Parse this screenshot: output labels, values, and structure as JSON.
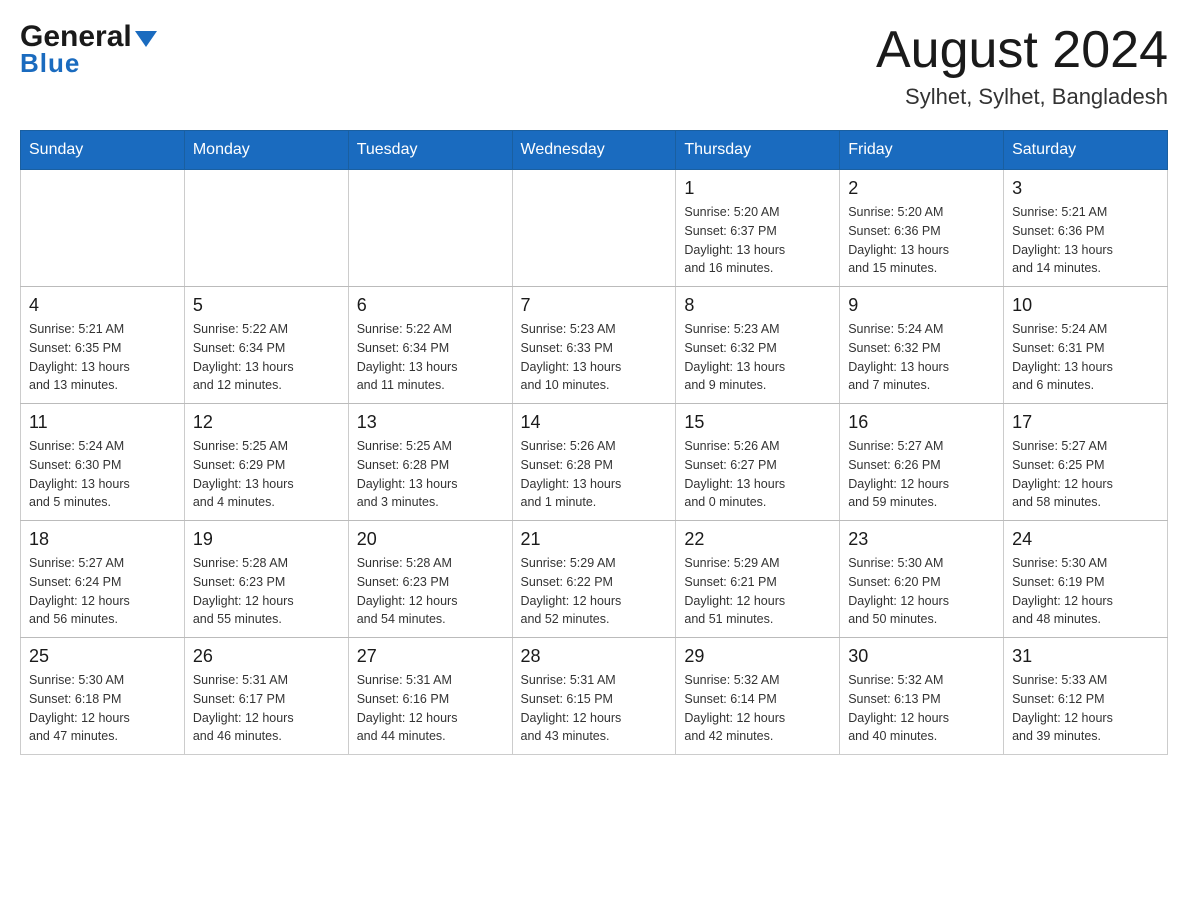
{
  "header": {
    "logo": {
      "general": "General",
      "blue": "Blue",
      "triangle": "▼"
    },
    "month_year": "August 2024",
    "location": "Sylhet, Sylhet, Bangladesh"
  },
  "calendar": {
    "days_of_week": [
      "Sunday",
      "Monday",
      "Tuesday",
      "Wednesday",
      "Thursday",
      "Friday",
      "Saturday"
    ],
    "weeks": [
      [
        {
          "day": "",
          "info": ""
        },
        {
          "day": "",
          "info": ""
        },
        {
          "day": "",
          "info": ""
        },
        {
          "day": "",
          "info": ""
        },
        {
          "day": "1",
          "info": "Sunrise: 5:20 AM\nSunset: 6:37 PM\nDaylight: 13 hours\nand 16 minutes."
        },
        {
          "day": "2",
          "info": "Sunrise: 5:20 AM\nSunset: 6:36 PM\nDaylight: 13 hours\nand 15 minutes."
        },
        {
          "day": "3",
          "info": "Sunrise: 5:21 AM\nSunset: 6:36 PM\nDaylight: 13 hours\nand 14 minutes."
        }
      ],
      [
        {
          "day": "4",
          "info": "Sunrise: 5:21 AM\nSunset: 6:35 PM\nDaylight: 13 hours\nand 13 minutes."
        },
        {
          "day": "5",
          "info": "Sunrise: 5:22 AM\nSunset: 6:34 PM\nDaylight: 13 hours\nand 12 minutes."
        },
        {
          "day": "6",
          "info": "Sunrise: 5:22 AM\nSunset: 6:34 PM\nDaylight: 13 hours\nand 11 minutes."
        },
        {
          "day": "7",
          "info": "Sunrise: 5:23 AM\nSunset: 6:33 PM\nDaylight: 13 hours\nand 10 minutes."
        },
        {
          "day": "8",
          "info": "Sunrise: 5:23 AM\nSunset: 6:32 PM\nDaylight: 13 hours\nand 9 minutes."
        },
        {
          "day": "9",
          "info": "Sunrise: 5:24 AM\nSunset: 6:32 PM\nDaylight: 13 hours\nand 7 minutes."
        },
        {
          "day": "10",
          "info": "Sunrise: 5:24 AM\nSunset: 6:31 PM\nDaylight: 13 hours\nand 6 minutes."
        }
      ],
      [
        {
          "day": "11",
          "info": "Sunrise: 5:24 AM\nSunset: 6:30 PM\nDaylight: 13 hours\nand 5 minutes."
        },
        {
          "day": "12",
          "info": "Sunrise: 5:25 AM\nSunset: 6:29 PM\nDaylight: 13 hours\nand 4 minutes."
        },
        {
          "day": "13",
          "info": "Sunrise: 5:25 AM\nSunset: 6:28 PM\nDaylight: 13 hours\nand 3 minutes."
        },
        {
          "day": "14",
          "info": "Sunrise: 5:26 AM\nSunset: 6:28 PM\nDaylight: 13 hours\nand 1 minute."
        },
        {
          "day": "15",
          "info": "Sunrise: 5:26 AM\nSunset: 6:27 PM\nDaylight: 13 hours\nand 0 minutes."
        },
        {
          "day": "16",
          "info": "Sunrise: 5:27 AM\nSunset: 6:26 PM\nDaylight: 12 hours\nand 59 minutes."
        },
        {
          "day": "17",
          "info": "Sunrise: 5:27 AM\nSunset: 6:25 PM\nDaylight: 12 hours\nand 58 minutes."
        }
      ],
      [
        {
          "day": "18",
          "info": "Sunrise: 5:27 AM\nSunset: 6:24 PM\nDaylight: 12 hours\nand 56 minutes."
        },
        {
          "day": "19",
          "info": "Sunrise: 5:28 AM\nSunset: 6:23 PM\nDaylight: 12 hours\nand 55 minutes."
        },
        {
          "day": "20",
          "info": "Sunrise: 5:28 AM\nSunset: 6:23 PM\nDaylight: 12 hours\nand 54 minutes."
        },
        {
          "day": "21",
          "info": "Sunrise: 5:29 AM\nSunset: 6:22 PM\nDaylight: 12 hours\nand 52 minutes."
        },
        {
          "day": "22",
          "info": "Sunrise: 5:29 AM\nSunset: 6:21 PM\nDaylight: 12 hours\nand 51 minutes."
        },
        {
          "day": "23",
          "info": "Sunrise: 5:30 AM\nSunset: 6:20 PM\nDaylight: 12 hours\nand 50 minutes."
        },
        {
          "day": "24",
          "info": "Sunrise: 5:30 AM\nSunset: 6:19 PM\nDaylight: 12 hours\nand 48 minutes."
        }
      ],
      [
        {
          "day": "25",
          "info": "Sunrise: 5:30 AM\nSunset: 6:18 PM\nDaylight: 12 hours\nand 47 minutes."
        },
        {
          "day": "26",
          "info": "Sunrise: 5:31 AM\nSunset: 6:17 PM\nDaylight: 12 hours\nand 46 minutes."
        },
        {
          "day": "27",
          "info": "Sunrise: 5:31 AM\nSunset: 6:16 PM\nDaylight: 12 hours\nand 44 minutes."
        },
        {
          "day": "28",
          "info": "Sunrise: 5:31 AM\nSunset: 6:15 PM\nDaylight: 12 hours\nand 43 minutes."
        },
        {
          "day": "29",
          "info": "Sunrise: 5:32 AM\nSunset: 6:14 PM\nDaylight: 12 hours\nand 42 minutes."
        },
        {
          "day": "30",
          "info": "Sunrise: 5:32 AM\nSunset: 6:13 PM\nDaylight: 12 hours\nand 40 minutes."
        },
        {
          "day": "31",
          "info": "Sunrise: 5:33 AM\nSunset: 6:12 PM\nDaylight: 12 hours\nand 39 minutes."
        }
      ]
    ]
  }
}
